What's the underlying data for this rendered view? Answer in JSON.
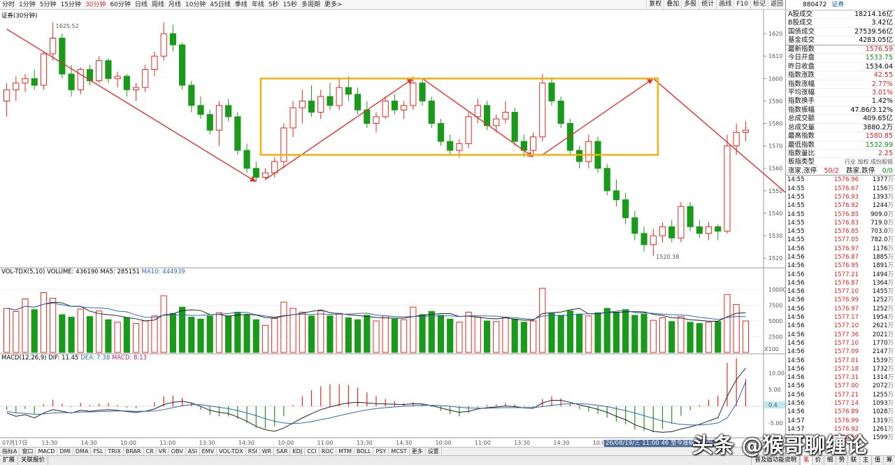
{
  "toolbar": {
    "periods": [
      "分时",
      "1分钟",
      "5分钟",
      "15分钟",
      "30分钟",
      "60分钟",
      "日线",
      "周线",
      "月线",
      "10分钟",
      "45日线",
      "季线",
      "年线",
      "5秒",
      "15秒",
      "多周期",
      "更多>"
    ],
    "active_period": "30分钟",
    "tools": [
      "复权",
      "叠加",
      "多股",
      "统计",
      "画线",
      "F10",
      "标记",
      "返回"
    ]
  },
  "main": {
    "title": "证券(30分钟)",
    "price_axis": [
      "1620",
      "1610",
      "1600",
      "1590",
      "1580",
      "1570",
      "1560",
      "1550",
      "1540",
      "1530",
      "1520"
    ],
    "high_label": "1625.52",
    "low_label": "1520.38"
  },
  "volume": {
    "title_prefix": "VOL-TDX(5,10)",
    "vol_label": "VOLUME: 436190",
    "ma5_label": "MA5: 285151",
    "ma10_label": "MA10: 444939",
    "axis": [
      "10000",
      "7500",
      "5000",
      "2500"
    ],
    "unit": "X100"
  },
  "macd": {
    "title": "MACD(12,26,9)",
    "dif_label": "DIF: 11.45",
    "dea_label": "DEA: 7.38",
    "macd_label": "MACD: 8.13",
    "axis": [
      "10.00",
      "5.00",
      "0.4",
      "-5.00"
    ],
    "highlight": "0.4"
  },
  "time_axis": [
    "07月17日",
    "13:30",
    "14:30",
    "10:00",
    "11:00",
    "13:30",
    "14:30",
    "10:00",
    "11:00",
    "13:30",
    "14:30",
    "10:00",
    "11:00",
    "13:30",
    "14:30",
    "10:00",
    "11:00",
    "13:30",
    "14:3"
  ],
  "status_line": "26/08/19/三 11:00 46 至今涨幅2.39%",
  "indicator_tabs": [
    "指标A",
    "窗口",
    "MACD",
    "DMI",
    "DMA",
    "FSL",
    "TRIX",
    "BRAR",
    "CR",
    "VR",
    "OBV",
    "ASI",
    "EMV",
    "VOL-TDX",
    "RSI",
    "WR",
    "SAR",
    "KDJ",
    "CCI",
    "ROC",
    "MTM",
    "BOLL",
    "PSY",
    "MCST",
    "更多",
    "设置"
  ],
  "active_indicator": "MACD",
  "bottom": {
    "left": [
      "扩展",
      "关联报价"
    ],
    "right_label": "普及版功能说明",
    "right_tabs": [
      "笔",
      "价",
      "细",
      "势",
      "联",
      "主",
      "值",
      "筹"
    ],
    "active_right": "笔"
  },
  "side": {
    "code": "880472",
    "name": "证券",
    "stats": [
      {
        "label": "A股成交",
        "value": "18214.16",
        "unit": "亿",
        "color": "#000"
      },
      {
        "label": "B股成交",
        "value": "3.42",
        "unit": "亿",
        "color": "#000"
      },
      {
        "label": "国债成交",
        "value": "27539.56",
        "unit": "亿",
        "color": "#000"
      },
      {
        "label": "基金成交",
        "value": "4283.05",
        "unit": "亿",
        "color": "#000"
      },
      {
        "label": "最新指数",
        "value": "1576.59",
        "unit": "",
        "color": "#e02020"
      },
      {
        "label": "今日开盘",
        "value": "1533.75",
        "unit": "",
        "color": "#129012"
      },
      {
        "label": "昨日收盘",
        "value": "1534.04",
        "unit": "",
        "color": "#000"
      },
      {
        "label": "指数涨跌",
        "value": "42.55",
        "unit": "",
        "color": "#e02020"
      },
      {
        "label": "指数涨幅",
        "value": "2.77%",
        "unit": "",
        "color": "#e02020"
      },
      {
        "label": "平均涨幅",
        "value": "3.01%",
        "unit": "",
        "color": "#e02020"
      },
      {
        "label": "指数换手",
        "value": "1.42%",
        "unit": "",
        "color": "#000"
      },
      {
        "label": "指数振幅",
        "value": "47.86/3.12%",
        "unit": "",
        "color": "#000"
      },
      {
        "label": "总成交额",
        "value": "409.65",
        "unit": "亿",
        "color": "#000"
      },
      {
        "label": "总成交量",
        "value": "3880.2",
        "unit": "万",
        "color": "#000"
      },
      {
        "label": "最高指数",
        "value": "1580.85",
        "unit": "",
        "color": "#e02020"
      },
      {
        "label": "最低指数",
        "value": "1532.99",
        "unit": "",
        "color": "#129012"
      },
      {
        "label": "指数量比",
        "value": "2.25",
        "unit": "",
        "color": "#e02020"
      }
    ],
    "board_type_label": "板指类型",
    "board_type_value": "行业 加权 成份股链",
    "updown_label": "涨家.涨停",
    "updown_value": "50/2",
    "downs_label": "跌家.跌停",
    "downs_value": "0/0",
    "ticks": [
      [
        "14:55",
        "1576.96",
        "1377",
        "万"
      ],
      [
        "14:55",
        "1576.67",
        "1156",
        "万"
      ],
      [
        "14:55",
        "1576.93",
        "1393",
        "万"
      ],
      [
        "14:55",
        "1576.92",
        "1244",
        "万"
      ],
      [
        "14:55",
        "1576.85",
        "909.0",
        "万"
      ],
      [
        "14:55",
        "1576.83",
        "719.0",
        "万"
      ],
      [
        "14:55",
        "1576.85",
        "703.0",
        "万"
      ],
      [
        "14:55",
        "1577.05",
        "782.0",
        "万"
      ],
      [
        "14:56",
        "1576.97",
        "1176",
        "万"
      ],
      [
        "14:56",
        "1576.87",
        "1885",
        "万"
      ],
      [
        "14:56",
        "1576.95",
        "1891",
        "万"
      ],
      [
        "14:56",
        "1577.21",
        "1494",
        "万"
      ],
      [
        "14:56",
        "1576.87",
        "1364",
        "万"
      ],
      [
        "14:56",
        "1577.10",
        "1455",
        "万"
      ],
      [
        "14:56",
        "1576.99",
        "1252",
        "万"
      ],
      [
        "14:56",
        "1576.97",
        "1252",
        "万"
      ],
      [
        "14:56",
        "1577.17",
        "1954",
        "万"
      ],
      [
        "14:56",
        "1577.10",
        "2621",
        "万"
      ],
      [
        "14:56",
        "1577.36",
        "2021",
        "万"
      ],
      [
        "14:56",
        "1577.10",
        "1770",
        "万"
      ],
      [
        "14:56",
        "1577.09",
        "2147",
        "万"
      ],
      [
        "14:56",
        "1577.01",
        "1539",
        "万"
      ],
      [
        "14:56",
        "1577.18",
        "1732",
        "万"
      ],
      [
        "14:56",
        "1577.31",
        "1314",
        "万"
      ],
      [
        "14:56",
        "1577.00",
        "2072",
        "万"
      ],
      [
        "14:56",
        "1577.21",
        "1255",
        "万"
      ],
      [
        "14:56",
        "1577.14",
        "1093",
        "万"
      ],
      [
        "14:56",
        "1576.89",
        "1028",
        "万"
      ],
      [
        "14:57",
        "1576.99",
        "1319",
        "万"
      ],
      [
        "14:57",
        "1576.92",
        "1261",
        "万"
      ],
      [
        "15:00",
        "1576.59",
        "1599",
        "万"
      ]
    ]
  },
  "watermark": "头条 @猴哥聊缠论",
  "chart_data": {
    "type": "candlestick",
    "title": "证券(30分钟)",
    "ylim": [
      1516,
      1630
    ],
    "ohlc": [
      [
        1590,
        1598,
        1583,
        1595
      ],
      [
        1595,
        1601,
        1590,
        1598
      ],
      [
        1598,
        1602,
        1594,
        1600
      ],
      [
        1600,
        1604,
        1595,
        1597
      ],
      [
        1597,
        1612,
        1595,
        1611
      ],
      [
        1611,
        1625,
        1608,
        1618
      ],
      [
        1618,
        1620,
        1600,
        1602
      ],
      [
        1602,
        1606,
        1592,
        1595
      ],
      [
        1595,
        1605,
        1593,
        1604
      ],
      [
        1604,
        1606,
        1597,
        1599
      ],
      [
        1599,
        1610,
        1598,
        1608
      ],
      [
        1608,
        1609,
        1598,
        1600
      ],
      [
        1600,
        1603,
        1596,
        1601
      ],
      [
        1601,
        1602,
        1592,
        1595
      ],
      [
        1595,
        1598,
        1590,
        1596
      ],
      [
        1596,
        1606,
        1594,
        1604
      ],
      [
        1604,
        1612,
        1601,
        1610
      ],
      [
        1610,
        1625,
        1608,
        1620
      ],
      [
        1620,
        1624,
        1612,
        1615
      ],
      [
        1615,
        1616,
        1595,
        1597
      ],
      [
        1597,
        1599,
        1585,
        1588
      ],
      [
        1588,
        1592,
        1582,
        1584
      ],
      [
        1584,
        1586,
        1575,
        1577
      ],
      [
        1577,
        1590,
        1570,
        1588
      ],
      [
        1588,
        1591,
        1581,
        1583
      ],
      [
        1583,
        1585,
        1566,
        1568
      ],
      [
        1568,
        1571,
        1558,
        1560
      ],
      [
        1560,
        1563,
        1554,
        1556
      ],
      [
        1556,
        1560,
        1555,
        1558
      ],
      [
        1558,
        1565,
        1556,
        1563
      ],
      [
        1563,
        1580,
        1560,
        1578
      ],
      [
        1578,
        1590,
        1574,
        1587
      ],
      [
        1587,
        1595,
        1580,
        1590
      ],
      [
        1590,
        1597,
        1583,
        1585
      ],
      [
        1585,
        1595,
        1582,
        1592
      ],
      [
        1592,
        1598,
        1586,
        1588
      ],
      [
        1588,
        1600,
        1586,
        1596
      ],
      [
        1596,
        1601,
        1590,
        1593
      ],
      [
        1593,
        1596,
        1584,
        1586
      ],
      [
        1586,
        1590,
        1578,
        1580
      ],
      [
        1580,
        1585,
        1576,
        1583
      ],
      [
        1583,
        1592,
        1582,
        1590
      ],
      [
        1590,
        1593,
        1584,
        1586
      ],
      [
        1586,
        1590,
        1582,
        1588
      ],
      [
        1588,
        1601,
        1586,
        1598
      ],
      [
        1598,
        1600,
        1588,
        1590
      ],
      [
        1590,
        1592,
        1578,
        1580
      ],
      [
        1580,
        1582,
        1570,
        1572
      ],
      [
        1572,
        1575,
        1566,
        1568
      ],
      [
        1568,
        1573,
        1565,
        1571
      ],
      [
        1571,
        1585,
        1569,
        1583
      ],
      [
        1583,
        1591,
        1580,
        1588
      ],
      [
        1588,
        1590,
        1577,
        1579
      ],
      [
        1579,
        1584,
        1576,
        1582
      ],
      [
        1582,
        1590,
        1580,
        1585
      ],
      [
        1585,
        1587,
        1570,
        1572
      ],
      [
        1572,
        1575,
        1565,
        1568
      ],
      [
        1568,
        1576,
        1566,
        1574
      ],
      [
        1574,
        1602,
        1572,
        1598
      ],
      [
        1598,
        1600,
        1588,
        1590
      ],
      [
        1590,
        1592,
        1578,
        1580
      ],
      [
        1580,
        1582,
        1566,
        1568
      ],
      [
        1568,
        1570,
        1560,
        1563
      ],
      [
        1563,
        1575,
        1560,
        1572
      ],
      [
        1572,
        1574,
        1558,
        1560
      ],
      [
        1560,
        1562,
        1548,
        1550
      ],
      [
        1550,
        1555,
        1543,
        1546
      ],
      [
        1546,
        1549,
        1535,
        1538
      ],
      [
        1538,
        1541,
        1528,
        1531
      ],
      [
        1531,
        1534,
        1523,
        1526
      ],
      [
        1526,
        1533,
        1521,
        1530
      ],
      [
        1530,
        1536,
        1527,
        1534
      ],
      [
        1534,
        1537,
        1527,
        1529
      ],
      [
        1529,
        1545,
        1527,
        1543
      ],
      [
        1543,
        1545,
        1532,
        1534
      ],
      [
        1534,
        1537,
        1529,
        1531
      ],
      [
        1531,
        1536,
        1528,
        1534
      ],
      [
        1534,
        1535,
        1528,
        1532
      ],
      [
        1532,
        1575,
        1531,
        1570
      ],
      [
        1570,
        1580,
        1566,
        1576
      ],
      [
        1576,
        1581,
        1572,
        1577
      ]
    ],
    "volume": [
      7000,
      6500,
      8500,
      6800,
      9500,
      8600,
      6000,
      5600,
      6900,
      5700,
      6600,
      5200,
      4800,
      5500,
      4600,
      5000,
      5800,
      9000,
      6200,
      7200,
      5600,
      5300,
      5800,
      6300,
      5800,
      6400,
      6000,
      5200,
      4300,
      5400,
      8000,
      7000,
      6400,
      5800,
      6600,
      5800,
      6200,
      5500,
      5200,
      5900,
      5000,
      5800,
      5300,
      5200,
      7200,
      6000,
      6500,
      5900,
      5300,
      4800,
      6400,
      5600,
      5000,
      4900,
      5600,
      5300,
      4800,
      5000,
      10200,
      6200,
      5900,
      6600,
      6100,
      5800,
      6300,
      7000,
      6400,
      6800,
      5900,
      6100,
      5100,
      5500,
      4900,
      5700,
      4800,
      4600,
      4800,
      4900,
      9200,
      7600,
      5000
    ],
    "dif": [
      -2,
      -3,
      -2.5,
      -3.5,
      -2,
      -1,
      -1.5,
      -2,
      -1.2,
      -1.5,
      -1.2,
      -1,
      -1.2,
      -1.6,
      -1.8,
      -1.5,
      -0.8,
      0.5,
      1.2,
      1.5,
      1,
      0,
      -1.2,
      -1.8,
      -2.2,
      -3.2,
      -4.5,
      -6,
      -7,
      -7.5,
      -6.5,
      -5,
      -3.5,
      -2.2,
      -1,
      -0.2,
      0.5,
      1,
      1.2,
      1,
      0.8,
      0.7,
      0.6,
      0.5,
      0.8,
      0.7,
      0.2,
      -0.5,
      -1.2,
      -1.8,
      -1.5,
      -0.8,
      -0.4,
      -0.2,
      0.1,
      -0.1,
      -0.5,
      -0.6,
      1,
      1.8,
      1.8,
      1.2,
      0.4,
      -0.2,
      -0.9,
      -1.8,
      -3,
      -4,
      -5.5,
      -6.5,
      -7.5,
      -7.8,
      -7.6,
      -6.8,
      -6.2,
      -5.4,
      -4.4,
      -3.4,
      3,
      8,
      11.45
    ],
    "dea": [
      -1.5,
      -2,
      -2.1,
      -2.4,
      -2.3,
      -2,
      -1.9,
      -1.9,
      -1.7,
      -1.7,
      -1.6,
      -1.5,
      -1.4,
      -1.4,
      -1.5,
      -1.5,
      -1.4,
      -1,
      -0.4,
      0.2,
      0.5,
      0.5,
      0.1,
      -0.3,
      -0.7,
      -1.3,
      -2,
      -2.8,
      -3.7,
      -4.5,
      -5,
      -5.2,
      -5,
      -4.6,
      -4,
      -3.5,
      -2.8,
      -2.2,
      -1.6,
      -1.1,
      -0.7,
      -0.4,
      -0.2,
      0,
      0.2,
      0.3,
      0.3,
      0.2,
      0,
      -0.3,
      -0.5,
      -0.6,
      -0.6,
      -0.5,
      -0.4,
      -0.4,
      -0.4,
      -0.4,
      -0.1,
      0.3,
      0.6,
      0.8,
      0.8,
      0.6,
      0.3,
      -0.1,
      -0.7,
      -1.3,
      -2,
      -2.8,
      -3.6,
      -4.4,
      -5,
      -5.4,
      -5.6,
      -5.6,
      -5.4,
      -5,
      -3.5,
      0.8,
      7.38
    ],
    "annotations": [
      {
        "type": "arrow",
        "from": [
          0,
          1622
        ],
        "to": [
          27,
          1554
        ]
      },
      {
        "type": "arrow",
        "from": [
          28,
          1555
        ],
        "to": [
          44,
          1600
        ]
      },
      {
        "type": "arrow",
        "from": [
          45,
          1600
        ],
        "to": [
          57,
          1565
        ]
      },
      {
        "type": "arrow",
        "from": [
          58,
          1566
        ],
        "to": [
          70,
          1600
        ]
      },
      {
        "type": "arrow",
        "from": [
          70,
          1600
        ],
        "to": [
          92,
          1522
        ]
      },
      {
        "type": "arrow",
        "from": [
          93,
          1522
        ],
        "to": [
          104,
          1581
        ]
      },
      {
        "type": "box",
        "x": [
          28,
          70
        ],
        "y": [
          1566,
          1600
        ]
      }
    ]
  }
}
